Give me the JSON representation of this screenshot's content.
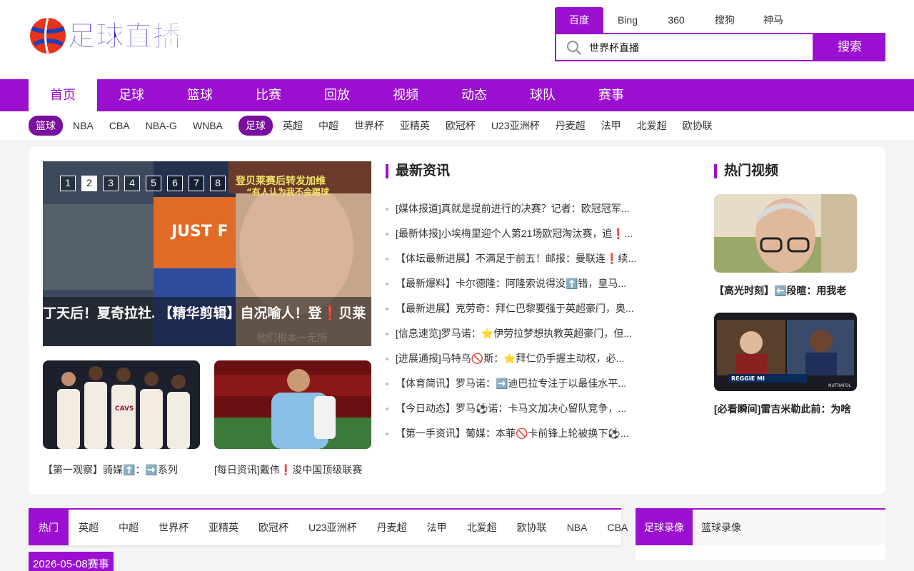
{
  "brand": {
    "logo_text": "足球直播"
  },
  "search": {
    "engines": [
      "百度",
      "Bing",
      "360",
      "搜狗",
      "神马"
    ],
    "active_engine": "百度",
    "value": "世界杯直播",
    "button": "搜索"
  },
  "main_nav": [
    "首页",
    "足球",
    "篮球",
    "比赛",
    "回放",
    "视频",
    "动态",
    "球队",
    "赛事"
  ],
  "sub_nav": {
    "basketball_tag": "篮球",
    "basketball": [
      "NBA",
      "CBA",
      "NBA-G",
      "WNBA"
    ],
    "football_tag": "足球",
    "football": [
      "英超",
      "中超",
      "世界杯",
      "亚精英",
      "欧冠杯",
      "U23亚洲杯",
      "丹麦超",
      "法甲",
      "北爱超",
      "欧协联"
    ]
  },
  "slider": {
    "pages": [
      "1",
      "2",
      "3",
      "4",
      "5",
      "6",
      "7",
      "8"
    ],
    "active_page": "2",
    "caption": "丁天后！夏奇拉社.   【精华剪辑】自况喻人！登❗贝莱",
    "overlay_text": "登贝莱赛后转发加维",
    "overlay_text2": "“有人认为我不会踢球",
    "banner_text": "JUST F",
    "subtitle_text": "他们根本一无所"
  },
  "thumbs": [
    {
      "caption": "【第一观察】骑媒⬆️：➡️系列",
      "jersey_text": "CAVS"
    },
    {
      "caption": "[每日资讯]戴伟❗浚中国顶级联赛"
    }
  ],
  "latest_news": {
    "title": "最新资讯",
    "items": [
      "[媒体报道]真就是提前进行的决赛？记者：欧冠冠军...",
      "[最新体报]小埃梅里迎个人第21场欧冠淘汰赛，追❗...",
      "【体坛最新进展】不满足于前五！邮报：曼联连❗续...",
      "【最新爆料】卡尔德隆：阿隆索说得没⬆️错，皇马...",
      "【最新进展】克劳奇：拜仁巴黎要强于英超豪门，奥...",
      "[信息速览]罗马诺：⭐伊劳拉梦想执教英超豪门，但...",
      "[进展通报]马特乌🚫斯：⭐拜仁仍手握主动权，必...",
      "【体育简讯】罗马诺：➡️迪巴拉专注于以最佳水平...",
      "【今日动态】罗马⚽诺：卡马文加决心留队竞争，...",
      "【第一手资讯】葡媒：本菲🚫卡前锋上轮被换下⚽..."
    ]
  },
  "hot_videos": {
    "title": "热门视频",
    "items": [
      {
        "caption": "【高光时刻】⬅️段暄：用我老"
      },
      {
        "caption": "[必看瞬间]雷吉米勒此前：为啥",
        "banner_text": "REGGIE MI",
        "corner_text": "NUTRAFOL"
      }
    ]
  },
  "tabs": {
    "items": [
      "热门",
      "英超",
      "中超",
      "世界杯",
      "亚精英",
      "欧冠杯",
      "U23亚洲杯",
      "丹麦超",
      "法甲",
      "北爱超",
      "欧协联",
      "NBA",
      "CBA"
    ],
    "active": "热门"
  },
  "replay_tabs": {
    "items": [
      "足球录像",
      "篮球录像"
    ],
    "active": "足球录像"
  },
  "date_badge": "2026-05-08赛事",
  "colors": {
    "accent": "#9b10d0",
    "tag_dark": "#7a0e9e"
  }
}
